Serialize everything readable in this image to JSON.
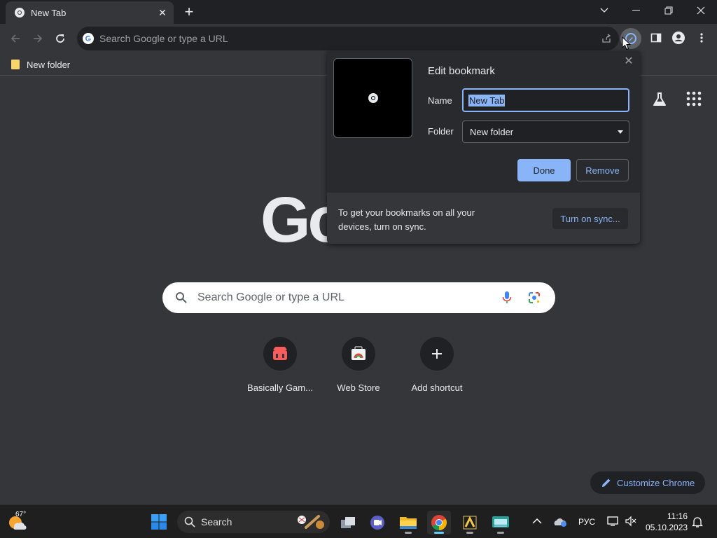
{
  "tab": {
    "title": "New Tab"
  },
  "toolbar": {
    "omnibox_placeholder": "Search Google or type a URL"
  },
  "bookmarks_bar": {
    "folder_label": "New folder"
  },
  "ntp": {
    "logo_text": "Go",
    "search_placeholder": "Search Google or type a URL",
    "shortcuts": [
      {
        "label": "Basically Gam...",
        "icon": "game-controller-icon"
      },
      {
        "label": "Web Store",
        "icon": "web-store-icon"
      },
      {
        "label": "Add shortcut",
        "icon": "plus-icon"
      }
    ],
    "customize_label": "Customize Chrome"
  },
  "dialog": {
    "title": "Edit bookmark",
    "name_label": "Name",
    "name_value": "New Tab",
    "folder_label": "Folder",
    "folder_value": "New folder",
    "done_label": "Done",
    "remove_label": "Remove",
    "sync_text": "To get your bookmarks on all your devices, turn on sync.",
    "sync_button": "Turn on sync..."
  },
  "taskbar": {
    "weather_temp": "67°",
    "search_label": "Search",
    "language": "РУС",
    "time": "11:16",
    "date": "05.10.2023"
  },
  "colors": {
    "accent": "#8ab4f8",
    "frame": "#202124",
    "toolbar": "#35363a",
    "dialog": "#292a2d"
  }
}
